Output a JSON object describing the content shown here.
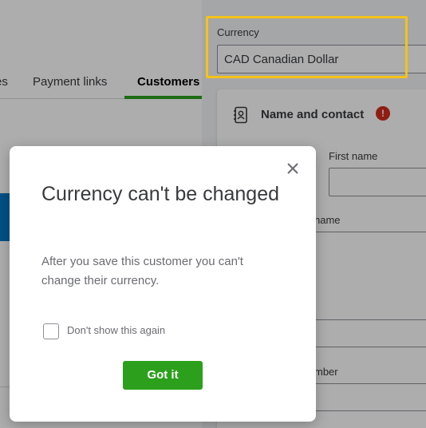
{
  "background": {
    "tabs": [
      {
        "label": "es"
      },
      {
        "label": "Payment links"
      },
      {
        "label": "Customers"
      }
    ]
  },
  "drawer": {
    "currency": {
      "label": "Currency",
      "value": "CAD Canadian Dollar"
    },
    "section": {
      "title": "Name and contact",
      "error_glyph": "!",
      "first_name_label": "First name",
      "partial_label_1": "name",
      "partial_label_2": "mber"
    }
  },
  "modal": {
    "title": "Currency can't be changed",
    "body": "After you save this customer you can't change their currency.",
    "checkbox_label": "Don't show this again",
    "button_label": "Got it"
  },
  "colors": {
    "accent_green": "#2ca01c",
    "highlight_yellow": "#f5c218",
    "error_red": "#d52b1e",
    "link_blue": "#0077c5"
  },
  "icons": {
    "close": "close-icon",
    "contact": "contact-book-icon",
    "error": "error-icon"
  }
}
